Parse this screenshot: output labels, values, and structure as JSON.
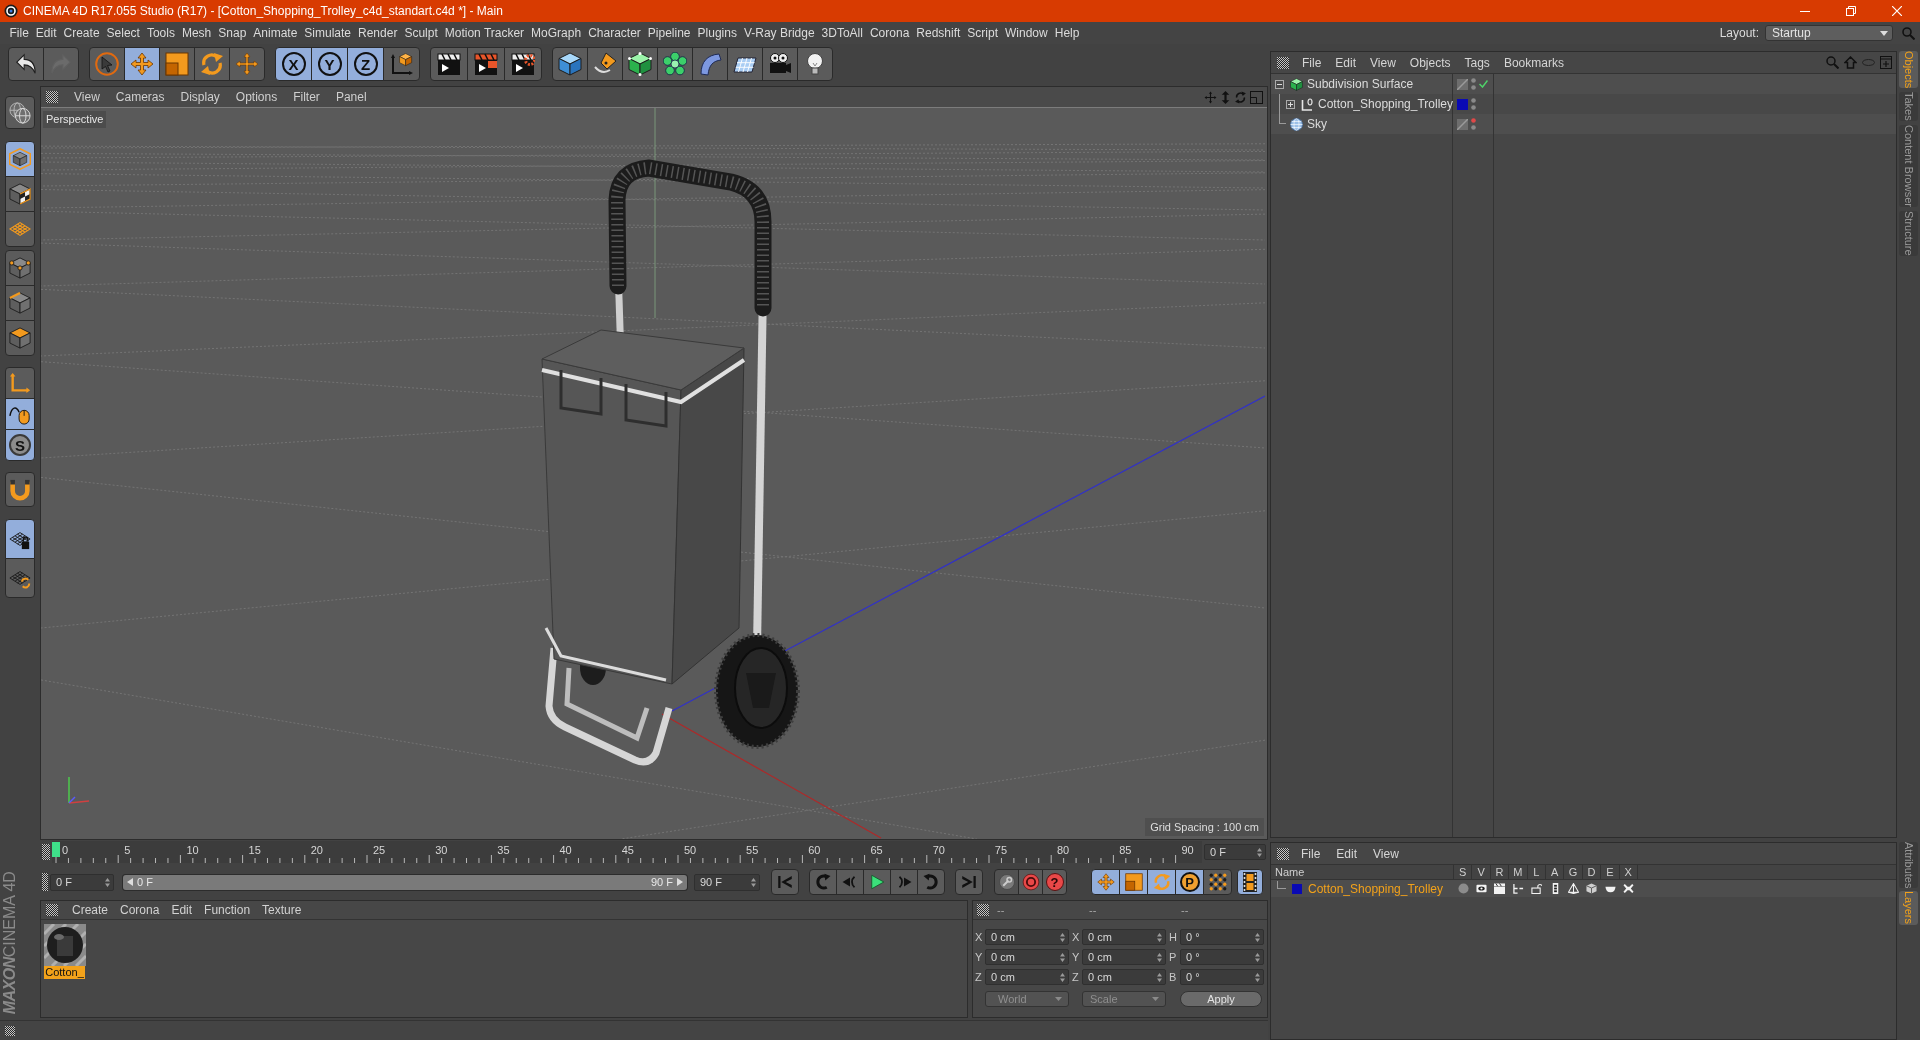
{
  "window": {
    "title": "CINEMA 4D R17.055 Studio (R17) - [Cotton_Shopping_Trolley_c4d_standart.c4d *] - Main"
  },
  "menu_bar": [
    "File",
    "Edit",
    "Create",
    "Select",
    "Tools",
    "Mesh",
    "Snap",
    "Animate",
    "Simulate",
    "Render",
    "Sculpt",
    "Motion Tracker",
    "MoGraph",
    "Character",
    "Pipeline",
    "Plugins",
    "V-Ray Bridge",
    "3DToAll",
    "Corona",
    "Redshift",
    "Script",
    "Window",
    "Help"
  ],
  "layout": {
    "label": "Layout:",
    "value": "Startup"
  },
  "toolbar": {
    "history": [
      {
        "disabled": false
      },
      {
        "disabled": true
      }
    ],
    "tools": [
      {
        "selected": false
      },
      {
        "selected": true
      },
      {
        "selected": false
      },
      {
        "selected": false
      },
      {
        "selected": false
      }
    ],
    "axis_locks": [
      {
        "label": "X",
        "selected": true
      },
      {
        "label": "Y",
        "selected": true
      },
      {
        "label": "Z",
        "selected": true
      }
    ],
    "coordinate_system": {
      "selected": false
    }
  },
  "mode_palette": [
    {
      "selected": false
    },
    {
      "selected": true
    },
    {
      "selected": false
    },
    {
      "selected": false
    },
    {
      "selected": false
    },
    {
      "selected": false
    },
    {
      "selected": false
    },
    {
      "selected": false
    },
    {
      "selected": true
    },
    {
      "label": "S",
      "selected": true
    },
    {
      "selected": false
    },
    {
      "selected": true
    },
    {
      "selected": false
    }
  ],
  "brand": {
    "company": "MAXON",
    "product": "CINEMA 4D"
  },
  "viewport": {
    "menu": [
      "View",
      "Cameras",
      "Display",
      "Options",
      "Filter",
      "Panel"
    ],
    "camera": "Perspective",
    "grid_spacing": "Grid Spacing : 100 cm"
  },
  "timeline": {
    "ruler": [
      "0",
      "5",
      "10",
      "15",
      "20",
      "25",
      "30",
      "35",
      "40",
      "45",
      "50",
      "55",
      "60",
      "65",
      "70",
      "75",
      "80",
      "85",
      "90"
    ],
    "playhead": {
      "level": 0
    },
    "current_frame": "0 F",
    "start_field": "0 F",
    "range": {
      "start": "0 F",
      "end": "90 F",
      "level": 1
    },
    "end_field": "90 F",
    "help_symbol": "?",
    "key_tools": [
      {
        "selected": true
      },
      {
        "selected": true
      },
      {
        "selected": true
      },
      {
        "label": "P",
        "selected": true
      },
      {
        "selected": false
      }
    ],
    "timeline_button": {
      "selected": true
    }
  },
  "material_manager": {
    "menu": [
      "Create",
      "Corona",
      "Edit",
      "Function",
      "Texture"
    ],
    "materials": [
      {
        "name": "Cotton_",
        "selected": true
      }
    ]
  },
  "coordinates": {
    "headers": [
      "--",
      "--",
      "--"
    ],
    "rows": [
      {
        "position_axis": "X",
        "position": "0 cm",
        "size_axis": "X",
        "size": "0 cm",
        "rotation_axis": "H",
        "rotation": "0 °"
      },
      {
        "position_axis": "Y",
        "position": "0 cm",
        "size_axis": "Y",
        "size": "0 cm",
        "rotation_axis": "P",
        "rotation": "0 °"
      },
      {
        "position_axis": "Z",
        "position": "0 cm",
        "size_axis": "Z",
        "size": "0 cm",
        "rotation_axis": "B",
        "rotation": "0 °"
      }
    ],
    "mode": "World",
    "size_mode": "Scale",
    "apply": "Apply"
  },
  "object_manager": {
    "menu": [
      "File",
      "Edit",
      "View",
      "Objects",
      "Tags",
      "Bookmarks"
    ],
    "objects": [
      {
        "name": "Subdivision Surface",
        "has_children": true,
        "expanded": true,
        "enabled": true,
        "editor_hidden": false,
        "children": [
          {
            "name": "Cotton_Shopping_Trolley",
            "has_children": true,
            "expanded": false,
            "enabled": false,
            "editor_hidden": false,
            "color": "#0a0ab4"
          }
        ]
      },
      {
        "name": "Sky",
        "has_children": false,
        "expanded": false,
        "enabled": false,
        "editor_hidden": true
      }
    ]
  },
  "object_tabs": [
    {
      "label": "Objects",
      "selected": true
    },
    {
      "label": "Takes",
      "selected": false
    },
    {
      "label": "Content Browser",
      "selected": false
    },
    {
      "label": "Structure",
      "selected": false
    }
  ],
  "layer_manager": {
    "menu": [
      "File",
      "Edit",
      "View"
    ],
    "columns": [
      "Name",
      "S",
      "V",
      "R",
      "M",
      "L",
      "A",
      "G",
      "D",
      "E",
      "X"
    ],
    "layers": [
      {
        "name": "Cotton_Shopping_Trolley",
        "color": "#0a0ab4"
      }
    ]
  },
  "layer_tabs": [
    {
      "label": "Attributes",
      "selected": false
    },
    {
      "label": "Layers",
      "selected": true
    }
  ]
}
